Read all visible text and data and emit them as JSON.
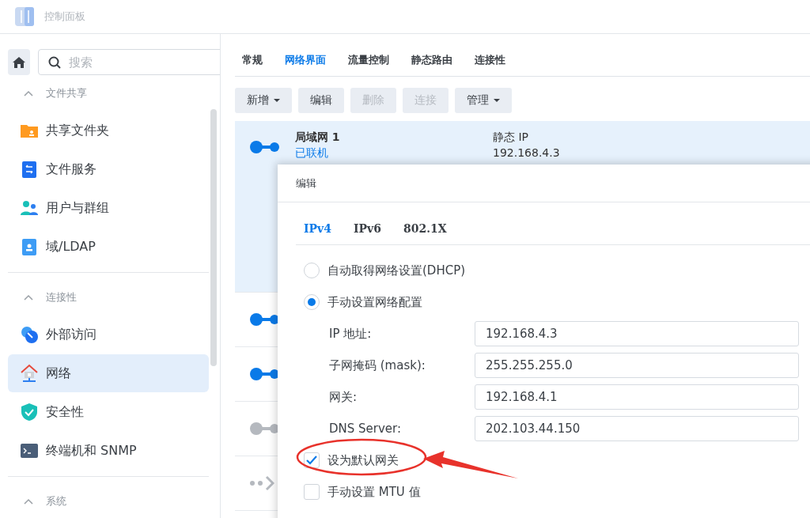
{
  "window": {
    "title": "控制面板"
  },
  "sidebar": {
    "search": {
      "placeholder": "搜索"
    },
    "sections": [
      {
        "title": "文件共享",
        "expanded": true,
        "items": [
          {
            "label": "共享文件夹",
            "kind": "folder",
            "selected": false
          },
          {
            "label": "文件服务",
            "kind": "fileservice",
            "selected": false
          },
          {
            "label": "用户与群组",
            "kind": "users",
            "selected": false
          },
          {
            "label": "域/LDAP",
            "kind": "card",
            "selected": false
          }
        ]
      },
      {
        "title": "连接性",
        "expanded": true,
        "items": [
          {
            "label": "外部访问",
            "kind": "external",
            "selected": false
          },
          {
            "label": "网络",
            "kind": "house",
            "selected": true
          },
          {
            "label": "安全性",
            "kind": "shield",
            "selected": false
          },
          {
            "label": "终端机和 SNMP",
            "kind": "terminal",
            "selected": false
          }
        ]
      },
      {
        "title": "系统",
        "expanded": true
      }
    ]
  },
  "tabs": [
    {
      "label": "常规",
      "selected": false
    },
    {
      "label": "网络界面",
      "selected": true
    },
    {
      "label": "流量控制",
      "selected": false
    },
    {
      "label": "静态路由",
      "selected": false
    },
    {
      "label": "连接性",
      "selected": false
    }
  ],
  "toolbar": [
    {
      "label": "新增",
      "dropdown": true,
      "disabled": false
    },
    {
      "label": "编辑",
      "dropdown": false,
      "disabled": false
    },
    {
      "label": "删除",
      "dropdown": false,
      "disabled": true
    },
    {
      "label": "连接",
      "dropdown": false,
      "disabled": true
    },
    {
      "label": "管理",
      "dropdown": true,
      "disabled": false
    }
  ],
  "interfaces": [
    {
      "kind": "lan",
      "name": "局域网 1",
      "status": "已联机",
      "mode": "静态 IP",
      "address": "192.168.4.3",
      "color": "#0a7ae8",
      "selected": true
    },
    {
      "kind": "lan",
      "color": "#0a7ae8",
      "selected": false
    },
    {
      "kind": "lan",
      "color": "#0a7ae8",
      "selected": false
    },
    {
      "kind": "lan",
      "color": "#b5b9bf",
      "selected": false
    },
    {
      "kind": "vpn",
      "color": "#b5b9bf",
      "selected": false
    }
  ],
  "dialog": {
    "title": "编辑",
    "tabs": [
      {
        "label": "IPv4",
        "selected": true
      },
      {
        "label": "IPv6",
        "selected": false
      },
      {
        "label": "802.1X",
        "selected": false
      }
    ],
    "options": [
      {
        "label": "自动取得网络设置(DHCP)",
        "selected": false
      },
      {
        "label": "手动设置网络配置",
        "selected": true
      }
    ],
    "fields": [
      {
        "label": "IP 地址:",
        "value": "192.168.4.3"
      },
      {
        "label": "子网掩码 (mask):",
        "value": "255.255.255.0"
      },
      {
        "label": "网关:",
        "value": "192.168.4.1"
      },
      {
        "label": "DNS Server:",
        "value": "202.103.44.150"
      }
    ],
    "checkboxes": [
      {
        "label": "设为默认网关",
        "checked": true
      },
      {
        "label": "手动设置 MTU 值",
        "checked": false
      }
    ]
  }
}
